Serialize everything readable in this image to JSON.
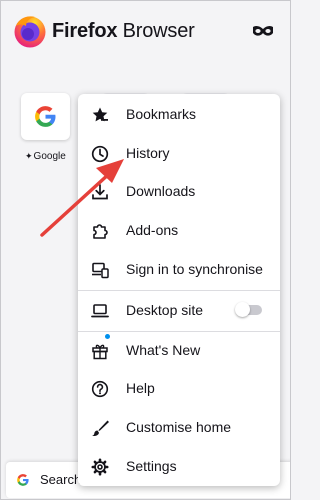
{
  "header": {
    "brand_bold": "Firefox",
    "brand_rest": " Browser"
  },
  "shortcuts": [
    {
      "label": "Google"
    }
  ],
  "search": {
    "text": "Search"
  },
  "menu": {
    "items": [
      {
        "label": "Bookmarks",
        "icon": "star-icon"
      },
      {
        "label": "History",
        "icon": "clock-icon"
      },
      {
        "label": "Downloads",
        "icon": "download-icon"
      },
      {
        "label": "Add-ons",
        "icon": "puzzle-icon"
      },
      {
        "label": "Sign in to synchronise",
        "icon": "sync-device-icon"
      },
      {
        "label": "Desktop site",
        "icon": "laptop-icon",
        "toggle": false
      },
      {
        "label": "What's New",
        "icon": "gift-icon",
        "badge": true
      },
      {
        "label": "Help",
        "icon": "help-icon"
      },
      {
        "label": "Customise home",
        "icon": "brush-icon"
      },
      {
        "label": "Settings",
        "icon": "gear-icon"
      }
    ]
  },
  "colors": {
    "arrow": "#e5403a",
    "badge": "#0090ed",
    "accent": "#ff7139"
  }
}
